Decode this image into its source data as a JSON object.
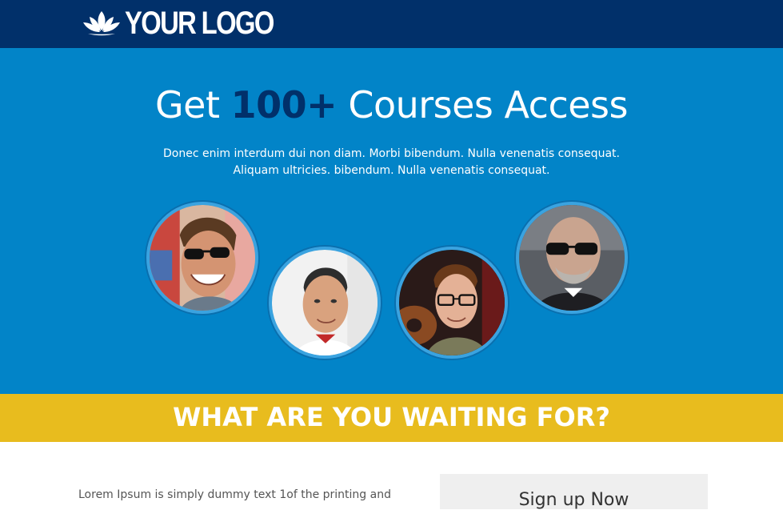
{
  "header": {
    "logo_text": "YOUR LOGO",
    "logo_icon": "lotus-icon"
  },
  "hero": {
    "title_pre": "Get ",
    "title_highlight": "100+",
    "title_post": " Courses Access",
    "subtitle_line1": "Donec enim interdum dui non diam. Morbi bibendum. Nulla venenatis consequat.",
    "subtitle_line2": "Aliquam ultricies. bibendum. Nulla venenatis consequat."
  },
  "instructors": [
    {
      "photo": "man-sunglasses-smiling"
    },
    {
      "photo": "man-smiling-portrait"
    },
    {
      "photo": "man-glasses-guitar"
    },
    {
      "photo": "bald-man-sunglasses"
    }
  ],
  "banner": {
    "text": "WHAT ARE YOU WAITING FOR?"
  },
  "content": {
    "body_text": "Lorem Ipsum is simply dummy text 1of the printing and"
  },
  "signup": {
    "title": "Sign up Now"
  },
  "colors": {
    "header_bg": "#01306a",
    "hero_bg": "#0284c8",
    "accent": "#01306a",
    "banner_bg": "#e8bc1e"
  }
}
